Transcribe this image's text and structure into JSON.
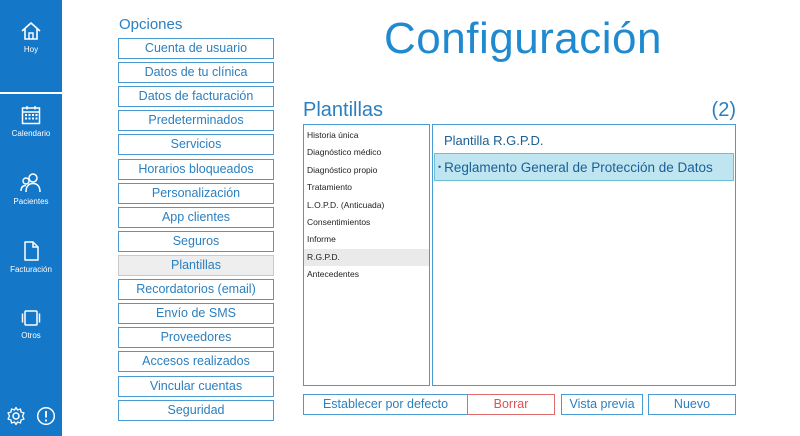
{
  "sidebar": {
    "items": [
      {
        "label": "Hoy",
        "icon": "home-icon"
      },
      {
        "label": "Calendario",
        "icon": "calendar-icon"
      },
      {
        "label": "Pacientes",
        "icon": "users-icon"
      },
      {
        "label": "Facturación",
        "icon": "document-icon"
      },
      {
        "label": "Otros",
        "icon": "stack-icon"
      }
    ],
    "bottom_icons": [
      "settings-gear-icon",
      "alert-info-icon"
    ],
    "background_color": "#1477c8"
  },
  "page_title": "Configuración",
  "options": {
    "title": "Opciones",
    "items": [
      "Cuenta de usuario",
      "Datos de tu clínica",
      "Datos de facturación",
      "Predeterminados",
      "Servicios",
      "Horarios bloqueados",
      "Personalización",
      "App clientes",
      "Seguros",
      "Plantillas",
      "Recordatorios (email)",
      "Envío de SMS",
      "Proveedores",
      "Accesos realizados",
      "Vincular cuentas",
      "Seguridad"
    ],
    "selected": "Plantillas"
  },
  "section": {
    "title": "Plantillas",
    "count": "(2)"
  },
  "template_list": {
    "items": [
      "Historia única",
      "Diagnóstico médico",
      "Diagnóstico propio",
      "Tratamiento",
      "L.O.P.D. (Anticuada)",
      "Consentimientos",
      "Informe",
      "R.G.P.D.",
      "Antecedentes"
    ],
    "selected": "R.G.P.D."
  },
  "detail": {
    "title": "Plantilla R.G.P.D.",
    "bullet": "•",
    "item": "Reglamento General de Protección de Datos"
  },
  "actions": {
    "default_label": "Establecer por defecto",
    "delete_label": "Borrar",
    "preview_label": "Vista previa",
    "new_label": "Nuevo"
  },
  "colors": {
    "accent": "#2a7fc0",
    "title": "#1f8ad0",
    "delete": "#d9534f",
    "selected_item_bg": "#bfe6f0"
  }
}
